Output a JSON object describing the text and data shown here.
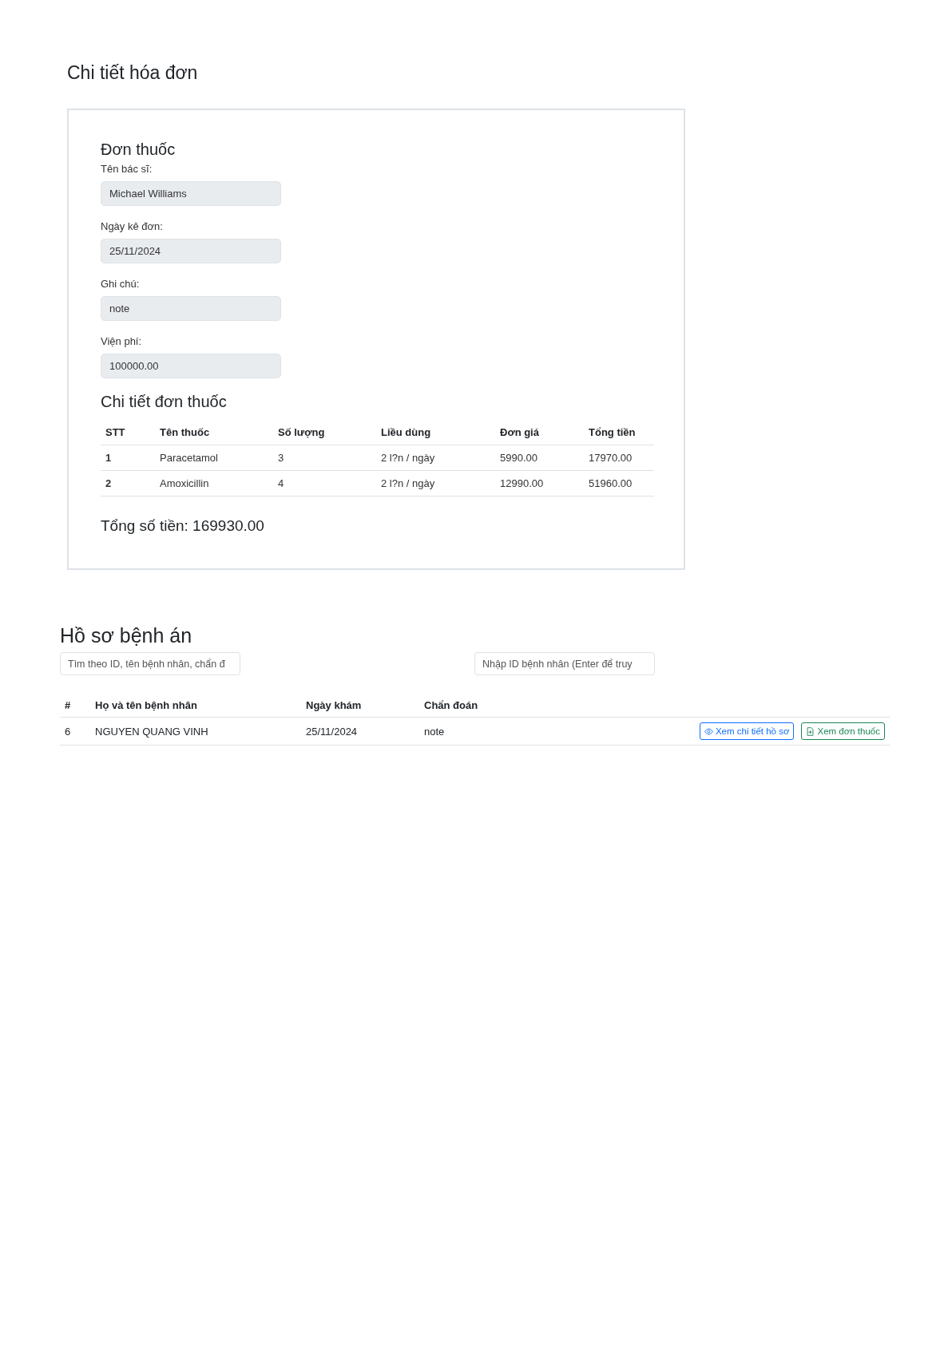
{
  "invoice": {
    "title": "Chi tiết hóa đơn",
    "prescription": {
      "heading": "Đơn thuốc",
      "fields": [
        {
          "label": "Tên bác sĩ:",
          "value": "Michael Williams"
        },
        {
          "label": "Ngày kê đơn:",
          "value": "25/11/2024"
        },
        {
          "label": "Ghi chú:",
          "value": "note"
        },
        {
          "label": "Viện phí:",
          "value": "100000.00"
        }
      ]
    },
    "details": {
      "heading": "Chi tiết đơn thuốc",
      "columns": [
        "STT",
        "Tên thuốc",
        "Số lượng",
        "Liều dùng",
        "Đơn giá",
        "Tổng tiền"
      ],
      "rows": [
        [
          "1",
          "Paracetamol",
          "3",
          "2 l?n / ngày",
          "5990.00",
          "17970.00"
        ],
        [
          "2",
          "Amoxicillin",
          "4",
          "2 l?n / ngày",
          "12990.00",
          "51960.00"
        ]
      ]
    },
    "total": "Tổng số tiền: 169930.00"
  },
  "records": {
    "title": "Hồ sơ bệnh án",
    "search": {
      "placeholder": "Tìm theo ID, tên bệnh nhân, chẩn đ"
    },
    "patient_id": {
      "placeholder": "Nhập ID bệnh nhân (Enter để truy"
    },
    "columns": [
      "#",
      "Họ và tên bệnh nhân",
      "Ngày khám",
      "Chẩn đoán"
    ],
    "rows": [
      {
        "cells": [
          "6",
          "NGUYEN QUANG VINH",
          "25/11/2024",
          "note"
        ],
        "actions": [
          {
            "kind": "view",
            "label": "Xem chi tiết hồ sơ"
          },
          {
            "kind": "prescription",
            "label": "Xem đơn thuốc"
          }
        ]
      }
    ]
  }
}
